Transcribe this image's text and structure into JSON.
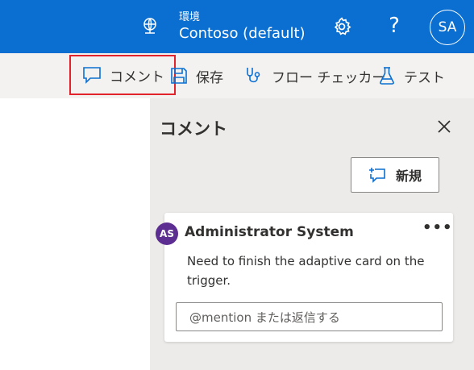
{
  "header": {
    "env_label": "環境",
    "env_name": "Contoso (default)",
    "help_label": "?",
    "avatar_initials": "SA"
  },
  "command_bar": {
    "comment_label": "コメント",
    "save_label": "保存",
    "flow_checker_label": "フロー チェッカー",
    "test_label": "テスト"
  },
  "comments_panel": {
    "title": "コメント",
    "new_button_label": "新規",
    "comment": {
      "avatar_initials": "AS",
      "author": "Administrator System",
      "body": "Need to finish the adaptive card on the trigger.",
      "more_label": "•••",
      "reply_placeholder": "@mention または返信する"
    }
  },
  "colors": {
    "header_bg": "#0b6fd1",
    "command_bar_bg": "#f3f2f1",
    "panel_bg": "#edebe9",
    "highlight_border": "#e3232b",
    "avatar_bg": "#5c2e91",
    "icon_blue": "#0b6fd1"
  },
  "icons": [
    "globe-icon",
    "gear-icon",
    "comment-icon",
    "save-icon",
    "stethoscope-icon",
    "flask-icon",
    "close-icon",
    "new-comment-icon",
    "more-icon"
  ]
}
